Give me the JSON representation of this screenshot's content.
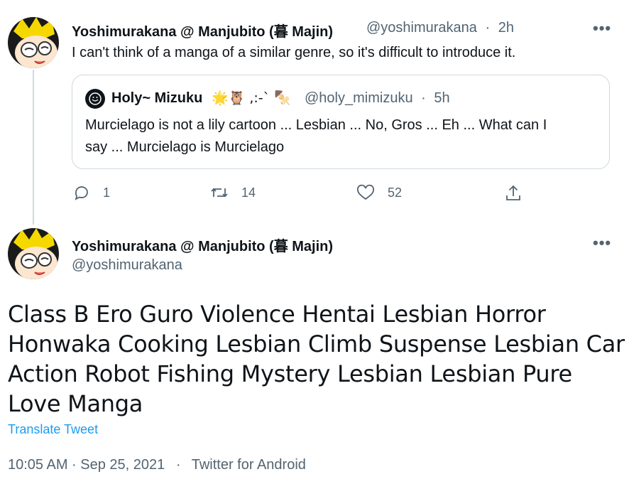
{
  "reply_tweet": {
    "display_name": "Yoshimurakana @ Manjubito (暮 Majin)",
    "handle": "@yoshimurakana",
    "separator": "·",
    "time": "2h",
    "text": "I can't think of a manga of a similar genre, so it's difficult to introduce it.",
    "quoted": {
      "display_name": "Holy~ Mizuku",
      "emoji": "🌟🦉 ,:-` 🍢",
      "handle": "@holy_mimizuku",
      "separator": "·",
      "time": "5h",
      "text_line1": "Murcielago is not a lily cartoon ... Lesbian ... No, Gros ... Eh ... What can I",
      "text_line2": "say ... Murcielago is Murcielago"
    },
    "actions": {
      "reply_count": "1",
      "retweet_count": "14",
      "like_count": "52"
    }
  },
  "main_tweet": {
    "display_name": "Yoshimurakana @ Manjubito (暮 Majin)",
    "handle": "@yoshimurakana",
    "text_lines": [
      "Class B Ero Guro Violence Hentai Lesbian Horror",
      "Honwaka Cooking Lesbian Climb Suspense Lesbian Car",
      "Action Robot Fishing Mystery Lesbian Lesbian Pure",
      "Love Manga"
    ],
    "translate_label": "Translate Tweet",
    "timestamp": "10:05 AM · Sep 25, 2021",
    "separator": "·",
    "source": "Twitter for Android"
  },
  "colors": {
    "link": "#1d9bf0",
    "muted": "#536471",
    "border": "#cfd9de"
  },
  "icons": {
    "more": "more-icon",
    "reply": "reply-icon",
    "retweet": "retweet-icon",
    "like": "like-icon",
    "share": "share-icon"
  }
}
